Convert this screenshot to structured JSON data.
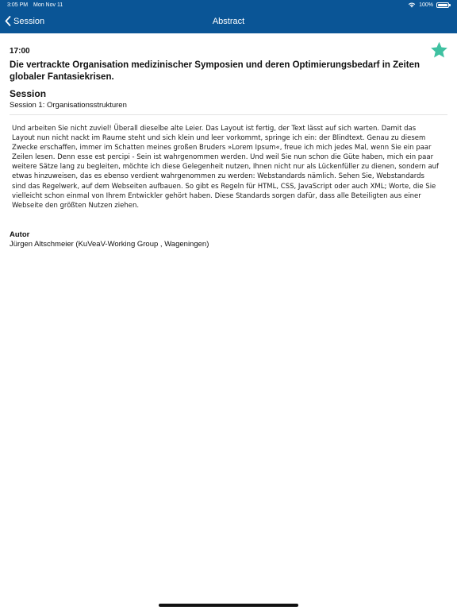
{
  "status_bar": {
    "time": "3:05 PM",
    "date": "Mon Nov 11",
    "battery": "100%",
    "battery_level": 1.0,
    "icons": [
      "wifi-icon",
      "battery-icon"
    ]
  },
  "nav": {
    "back_label": "Session",
    "back_icon": "chevron-left-icon",
    "title": "Abstract",
    "bar_color": "#0a5596"
  },
  "detail": {
    "time": "17:00",
    "favorite_icon": "star-icon",
    "favorite_color": "#3fc1a1",
    "title": "Die vertrackte Organisation medizinischer Symposien und deren Optimierungsbedarf in Zeiten globaler Fantasiekrisen.",
    "session_heading": "Session",
    "session_value": "Session 1: Organisationsstrukturen",
    "abstract": "Und arbeiten Sie nicht zuviel! Überall dieselbe alte Leier. Das Layout ist fertig, der Text lässt auf sich warten. Damit das Layout nun nicht nackt im Raume steht und sich klein und leer vorkommt, springe ich ein: der Blindtext. Genau zu diesem Zwecke erschaffen, immer im Schatten meines großen Bruders »Lorem Ipsum«, freue ich mich jedes Mal, wenn Sie ein paar Zeilen lesen. Denn esse est percipi - Sein ist wahrgenommen werden. Und weil Sie nun schon die Güte haben, mich ein paar weitere Sätze lang zu begleiten, möchte ich diese Gelegenheit nutzen, Ihnen nicht nur als Lückenfüller zu dienen, sondern auf etwas hinzuweisen, das es ebenso verdient wahrgenommen zu werden: Webstandards nämlich. Sehen Sie, Webstandards sind das Regelwerk, auf dem Webseiten aufbauen. So gibt es Regeln für HTML, CSS, JavaScript oder auch XML; Worte, die Sie vielleicht schon einmal von Ihrem Entwickler gehört haben. Diese Standards sorgen dafür, dass alle Beteiligten aus einer Webseite den größten Nutzen ziehen.",
    "author_heading": "Autor",
    "author_value": "Jürgen Altschmeier (KuVeaV-Working Group , Wageningen)"
  }
}
